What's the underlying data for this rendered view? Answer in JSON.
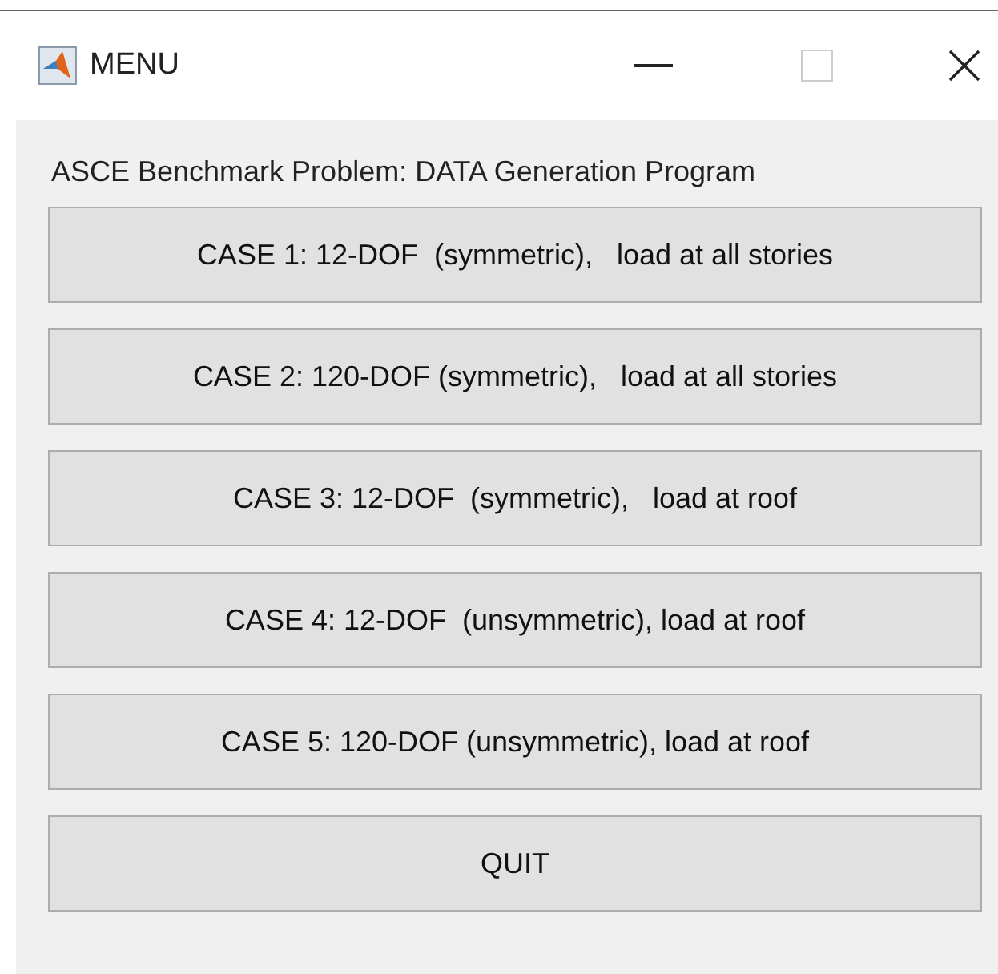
{
  "window": {
    "title": "MENU"
  },
  "heading": "ASCE Benchmark Problem: DATA Generation Program",
  "buttons": [
    "CASE 1: 12-DOF  (symmetric),   load at all stories",
    "CASE 2: 120-DOF (symmetric),   load at all stories",
    "CASE 3: 12-DOF  (symmetric),   load at roof",
    "CASE 4: 12-DOF  (unsymmetric), load at roof",
    "CASE 5: 120-DOF (unsymmetric), load at roof",
    "QUIT"
  ]
}
